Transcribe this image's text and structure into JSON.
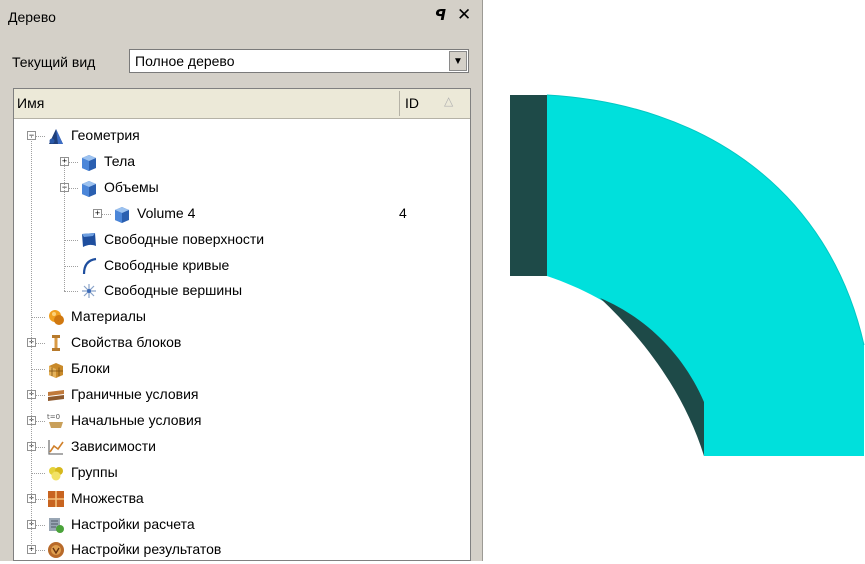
{
  "panel": {
    "title": "Дерево",
    "float_glyph": "ꟼ",
    "close_glyph": "✕"
  },
  "view": {
    "label": "Текущий вид",
    "selected": "Полное дерево",
    "arrow": "▼"
  },
  "tree": {
    "columns": {
      "name": "Имя",
      "id": "ID",
      "sort_glyph": "△"
    },
    "rows": [
      {
        "label": "Геометрия",
        "icon": "geometry-icon",
        "level": 0,
        "expander": "−",
        "id": ""
      },
      {
        "label": "Тела",
        "icon": "bodies-icon",
        "level": 1,
        "expander": "+",
        "id": ""
      },
      {
        "label": "Объемы",
        "icon": "volumes-icon",
        "level": 1,
        "expander": "−",
        "id": ""
      },
      {
        "label": "Volume 4",
        "icon": "volume-icon",
        "level": 2,
        "expander": "+",
        "id": "4"
      },
      {
        "label": "Свободные поверхности",
        "icon": "surface-icon",
        "level": 1,
        "expander": "",
        "id": ""
      },
      {
        "label": "Свободные кривые",
        "icon": "curve-icon",
        "level": 1,
        "expander": "",
        "id": ""
      },
      {
        "label": "Свободные вершины",
        "icon": "vertex-icon",
        "level": 1,
        "expander": "",
        "id": ""
      },
      {
        "label": "Материалы",
        "icon": "materials-icon",
        "level": 0,
        "expander": "",
        "id": ""
      },
      {
        "label": "Свойства блоков",
        "icon": "block-properties-icon",
        "level": 0,
        "expander": "+",
        "id": ""
      },
      {
        "label": "Блоки",
        "icon": "blocks-icon",
        "level": 0,
        "expander": "",
        "id": ""
      },
      {
        "label": "Граничные условия",
        "icon": "boundary-conditions-icon",
        "level": 0,
        "expander": "+",
        "id": ""
      },
      {
        "label": "Начальные условия",
        "icon": "initial-conditions-icon",
        "level": 0,
        "expander": "+",
        "id": ""
      },
      {
        "label": "Зависимости",
        "icon": "dependencies-icon",
        "level": 0,
        "expander": "+",
        "id": ""
      },
      {
        "label": "Группы",
        "icon": "groups-icon",
        "level": 0,
        "expander": "",
        "id": ""
      },
      {
        "label": "Множества",
        "icon": "sets-icon",
        "level": 0,
        "expander": "+",
        "id": ""
      },
      {
        "label": "Настройки расчета",
        "icon": "solver-settings-icon",
        "level": 0,
        "expander": "+",
        "id": ""
      },
      {
        "label": "Настройки результатов",
        "icon": "results-settings-icon",
        "level": 0,
        "expander": "+",
        "id": ""
      }
    ]
  },
  "colors": {
    "panel_bg": "#d4d0c8",
    "shape_face": "#00e0dc",
    "shape_dark": "#1e4a48"
  }
}
